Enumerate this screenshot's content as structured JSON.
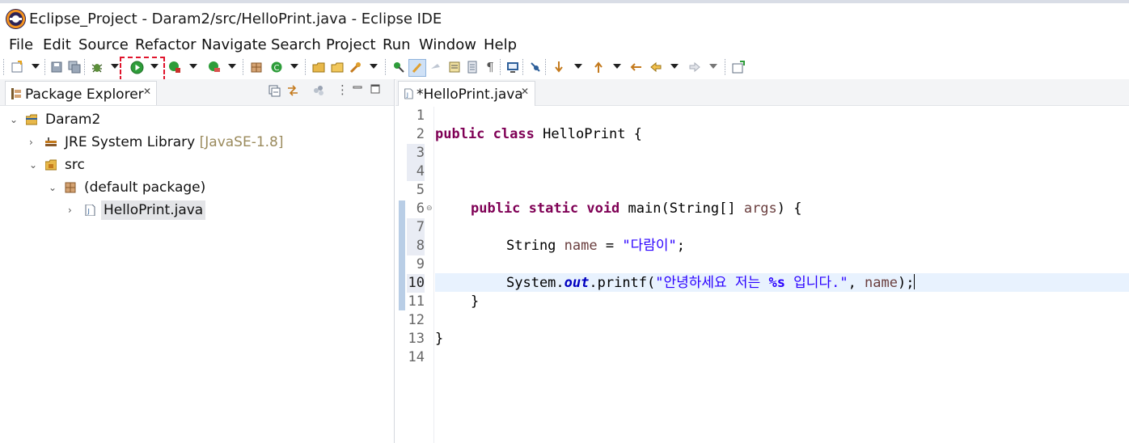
{
  "window": {
    "title": "Eclipse_Project - Daram2/src/HelloPrint.java - Eclipse IDE"
  },
  "menu": [
    "File",
    "Edit",
    "Source",
    "Refactor",
    "Navigate",
    "Search",
    "Project",
    "Run",
    "Window",
    "Help"
  ],
  "package_explorer": {
    "tab_label": "Package Explorer",
    "tree": [
      {
        "label": "Daram2",
        "expanded": true,
        "icon": "project-folder-icon"
      },
      {
        "label": "JRE System Library",
        "decoration": "[JavaSE-1.8]",
        "expanded": false,
        "icon": "library-icon"
      },
      {
        "label": "src",
        "expanded": true,
        "icon": "source-folder-icon"
      },
      {
        "label": "(default package)",
        "expanded": true,
        "icon": "package-icon"
      },
      {
        "label": "HelloPrint.java",
        "expanded": false,
        "icon": "java-file-icon",
        "selected": true
      }
    ]
  },
  "editor": {
    "tab_label": "*HelloPrint.java",
    "current_line": 10,
    "line_numbers": [
      "1",
      "2",
      "3",
      "4",
      "5",
      "6",
      "7",
      "8",
      "9",
      "10",
      "11",
      "12",
      "13",
      "14"
    ],
    "code": {
      "l2_kw1": "public",
      "l2_kw2": "class",
      "l2_rest": " HelloPrint {",
      "l6_kw1": "public",
      "l6_kw2": "static",
      "l6_kw3": "void",
      "l6_rest1": " main(String[] ",
      "l6_param": "args",
      "l6_rest2": ") {",
      "l8_type": "String ",
      "l8_var": "name",
      "l8_eq": " = ",
      "l8_str": "\"다람이\"",
      "l8_end": ";",
      "l10_a": "System.",
      "l10_field": "out",
      "l10_b": ".printf(",
      "l10_str1": "\"안녕하세요 저는 ",
      "l10_fmt": "%s",
      "l10_str2": " 입니다.\"",
      "l10_c": ", ",
      "l10_var": "name",
      "l10_d": ");",
      "l11": "}",
      "l13": "}"
    }
  },
  "colors": {
    "keyword": "#7f0055",
    "string": "#2a00ff",
    "field": "#0000c0",
    "local_variable": "#6a3e3e",
    "current_line_bg": "#e8f2fe",
    "run_highlight": "#e0142c"
  }
}
